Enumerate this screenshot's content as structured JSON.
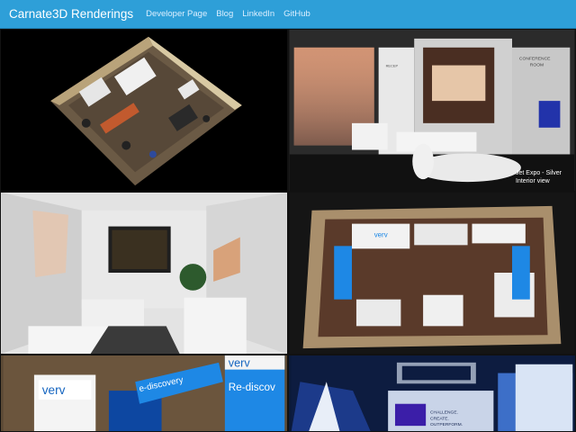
{
  "navbar": {
    "brand": "Carnate3D Renderings",
    "links": [
      "Developer Page",
      "Blog",
      "LinkedIn",
      "GitHub"
    ],
    "background": "#2e9fd8"
  },
  "gallery": {
    "tiles": [
      {
        "name": "render-1"
      },
      {
        "name": "render-2",
        "sign_left": "RECEP",
        "sign_right_line1": "CONFERENCE",
        "sign_right_line2": "ROOM",
        "caption_line1": "Jet Expo - Silver",
        "caption_line2": "Interior view"
      },
      {
        "name": "render-3"
      },
      {
        "name": "render-4",
        "logo_text": "verv"
      },
      {
        "name": "render-5",
        "logo_text": "verv",
        "banner_line1": "e-discovery",
        "banner_line2": "Re-discov"
      },
      {
        "name": "render-6",
        "panel_line1": "CHALLENGE.",
        "panel_line2": "CREATE.",
        "panel_line3": "OUTPERFORM."
      }
    ]
  }
}
